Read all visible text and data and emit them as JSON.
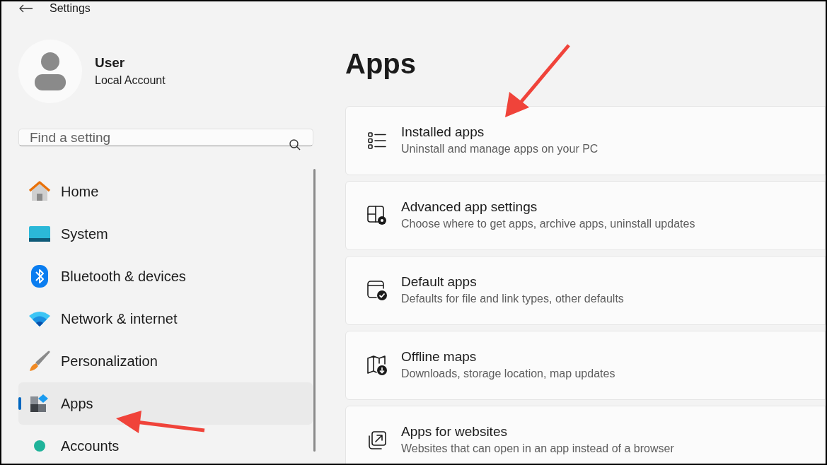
{
  "window": {
    "title": "Settings"
  },
  "account": {
    "name": "User",
    "type": "Local Account"
  },
  "search": {
    "placeholder": "Find a setting"
  },
  "sidebar": {
    "items": [
      {
        "label": "Home",
        "kind": "home",
        "selected": false
      },
      {
        "label": "System",
        "kind": "system",
        "selected": false
      },
      {
        "label": "Bluetooth & devices",
        "kind": "bluetooth",
        "selected": false
      },
      {
        "label": "Network & internet",
        "kind": "network",
        "selected": false
      },
      {
        "label": "Personalization",
        "kind": "brush",
        "selected": false
      },
      {
        "label": "Apps",
        "kind": "apps",
        "selected": true
      },
      {
        "label": "Accounts",
        "kind": "accounts",
        "selected": false
      }
    ]
  },
  "page": {
    "title": "Apps",
    "cards": [
      {
        "title": "Installed apps",
        "description": "Uninstall and manage apps on your PC",
        "kind": "list"
      },
      {
        "title": "Advanced app settings",
        "description": "Choose where to get apps, archive apps, uninstall updates",
        "kind": "gear"
      },
      {
        "title": "Default apps",
        "description": "Defaults for file and link types, other defaults",
        "kind": "check"
      },
      {
        "title": "Offline maps",
        "description": "Downloads, storage location, map updates",
        "kind": "map"
      },
      {
        "title": "Apps for websites",
        "description": "Websites that can open in an app instead of a browser",
        "kind": "open"
      }
    ]
  }
}
